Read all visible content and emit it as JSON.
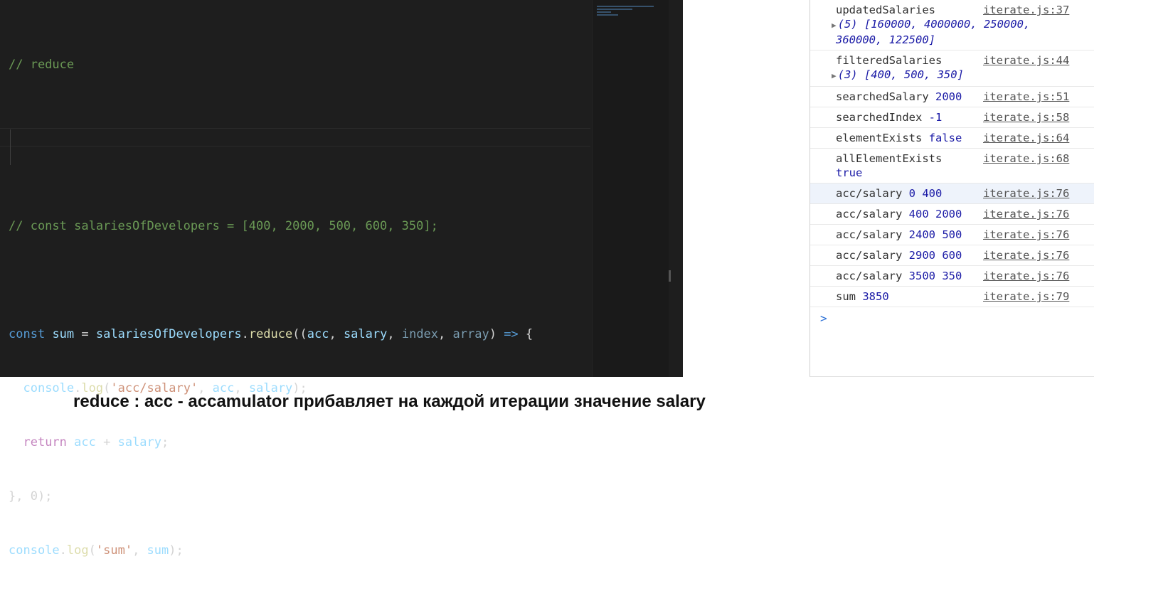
{
  "editor": {
    "lines": [
      "// reduce",
      "",
      "",
      "// const salariesOfDevelopers = [400, 2000, 500, 600, 350];",
      "",
      "const sum = salariesOfDevelopers.reduce((acc, salary, index, array) => {",
      "  console.log('acc/salary', acc, salary);",
      "  return acc + salary;",
      "}, 0);",
      "console.log('sum', sum);"
    ]
  },
  "console": {
    "rows": [
      {
        "label": "updatedSalaries",
        "value": "(5) [160000, 4000000, 250000, 360000, 122500]",
        "source": "iterate.js:37",
        "expandable": true
      },
      {
        "label": "filteredSalaries",
        "value": "(3) [400, 500, 350]",
        "source": "iterate.js:44",
        "expandable": true
      },
      {
        "label": "searchedSalary",
        "value": "2000",
        "source": "iterate.js:51"
      },
      {
        "label": "searchedIndex",
        "value": "-1",
        "source": "iterate.js:58"
      },
      {
        "label": "elementExists",
        "value": "false",
        "source": "iterate.js:64"
      },
      {
        "label": "allElementExists",
        "value": "true",
        "source": "iterate.js:68",
        "wrap": true
      },
      {
        "label": "acc/salary",
        "value": "0 400",
        "source": "iterate.js:76",
        "highlight": true
      },
      {
        "label": "acc/salary",
        "value": "400 2000",
        "source": "iterate.js:76"
      },
      {
        "label": "acc/salary",
        "value": "2400 500",
        "source": "iterate.js:76"
      },
      {
        "label": "acc/salary",
        "value": "2900 600",
        "source": "iterate.js:76"
      },
      {
        "label": "acc/salary",
        "value": "3500 350",
        "source": "iterate.js:76"
      },
      {
        "label": "sum",
        "value": "3850",
        "source": "iterate.js:79"
      }
    ],
    "prompt": ">"
  },
  "caption": "reduce : acc - accamulator прибавляет на каждой итерации значение salary"
}
